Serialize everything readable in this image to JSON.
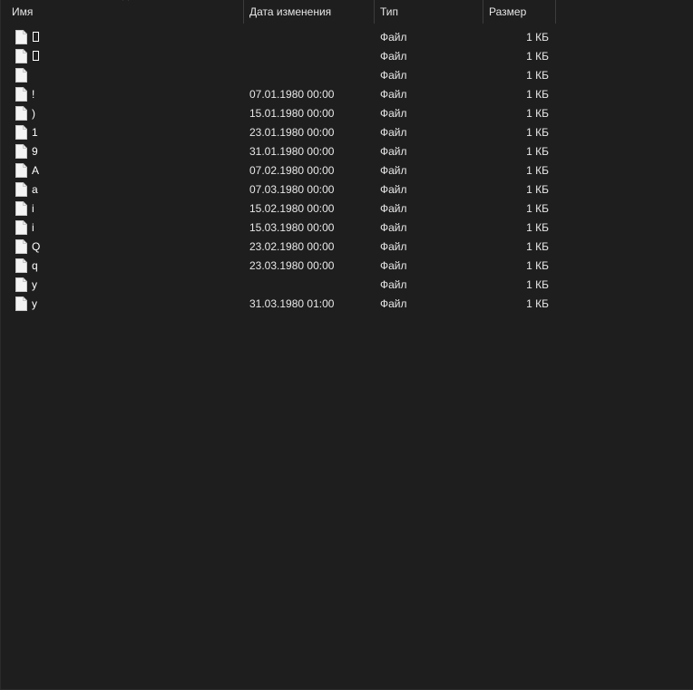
{
  "columns": {
    "name": "Имя",
    "date": "Дата изменения",
    "type": "Тип",
    "size": "Размер"
  },
  "sort": {
    "column": "name",
    "direction": "ascending",
    "icon": "chevron-up-icon"
  },
  "files": [
    {
      "name": "▯",
      "name_is_unrenderable": true,
      "date": "",
      "type": "Файл",
      "size": "1 КБ",
      "icon": "file-icon"
    },
    {
      "name": "▯",
      "name_is_unrenderable": true,
      "date": "",
      "type": "Файл",
      "size": "1 КБ",
      "icon": "file-icon"
    },
    {
      "name": "",
      "date": "",
      "type": "Файл",
      "size": "1 КБ",
      "icon": "file-icon"
    },
    {
      "name": "!",
      "date": "07.01.1980 00:00",
      "type": "Файл",
      "size": "1 КБ",
      "icon": "file-icon"
    },
    {
      "name": ")",
      "date": "15.01.1980 00:00",
      "type": "Файл",
      "size": "1 КБ",
      "icon": "file-icon"
    },
    {
      "name": "1",
      "date": "23.01.1980 00:00",
      "type": "Файл",
      "size": "1 КБ",
      "icon": "file-icon"
    },
    {
      "name": "9",
      "date": "31.01.1980 00:00",
      "type": "Файл",
      "size": "1 КБ",
      "icon": "file-icon"
    },
    {
      "name": "A",
      "date": "07.02.1980 00:00",
      "type": "Файл",
      "size": "1 КБ",
      "icon": "file-icon"
    },
    {
      "name": "a",
      "date": "07.03.1980 00:00",
      "type": "Файл",
      "size": "1 КБ",
      "icon": "file-icon"
    },
    {
      "name": "i",
      "date": "15.02.1980 00:00",
      "type": "Файл",
      "size": "1 КБ",
      "icon": "file-icon"
    },
    {
      "name": "i",
      "date": "15.03.1980 00:00",
      "type": "Файл",
      "size": "1 КБ",
      "icon": "file-icon"
    },
    {
      "name": "Q",
      "date": "23.02.1980 00:00",
      "type": "Файл",
      "size": "1 КБ",
      "icon": "file-icon"
    },
    {
      "name": "q",
      "date": "23.03.1980 00:00",
      "type": "Файл",
      "size": "1 КБ",
      "icon": "file-icon"
    },
    {
      "name": "y",
      "date": "",
      "type": "Файл",
      "size": "1 КБ",
      "icon": "file-icon"
    },
    {
      "name": "y",
      "date": "31.03.1980 01:00",
      "type": "Файл",
      "size": "1 КБ",
      "icon": "file-icon"
    }
  ],
  "colors": {
    "background": "#1e1e1e",
    "text": "#ffffff",
    "header_separator": "#3c3c3c"
  }
}
